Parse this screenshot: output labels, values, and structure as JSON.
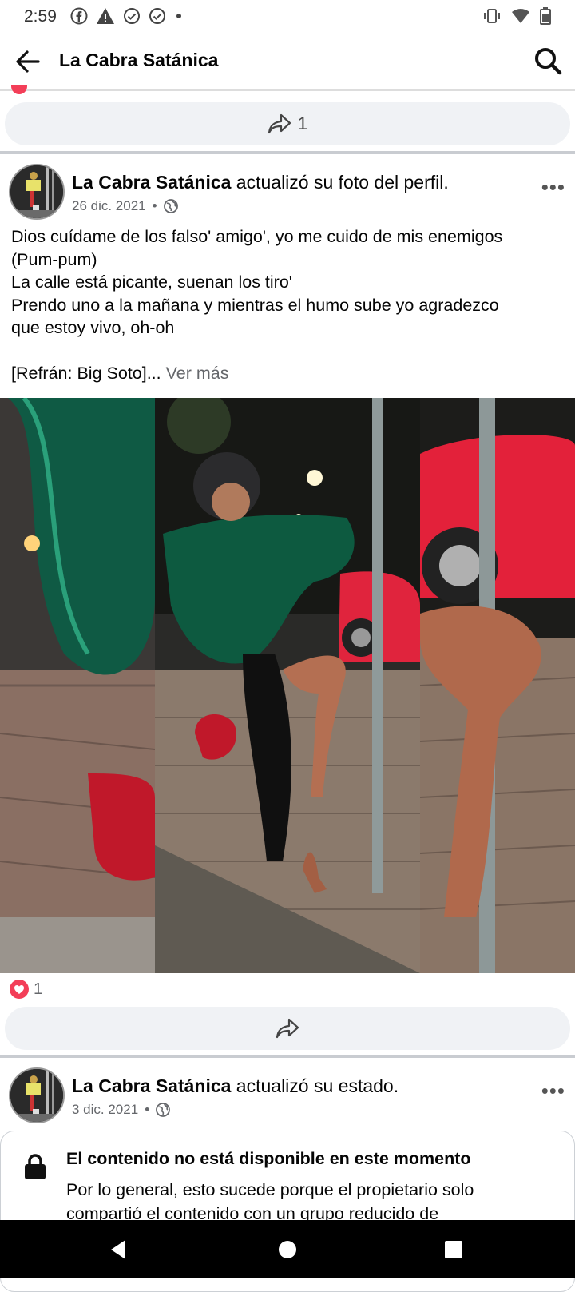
{
  "status_bar": {
    "time": "2:59"
  },
  "header": {
    "title": "La Cabra Satánica"
  },
  "prev_post": {
    "share_count": "1"
  },
  "post1": {
    "author": "La Cabra Satánica",
    "action": " actualizó su foto del perfil.",
    "date": "26 dic. 2021",
    "lines": [
      "Dios cuídame de los falso' amigo', yo me cuido de mis enemigos",
      "(Pum-pum)",
      "La calle está picante, suenan los tiro'",
      "Prendo uno a la mañana y mientras el humo sube yo agradezco",
      "que estoy vivo, oh-oh",
      "",
      "[Refrán: Big Soto]..."
    ],
    "see_more": "Ver más",
    "reaction_count": "1"
  },
  "post2": {
    "author": "La Cabra Satánica",
    "action": " actualizó su estado.",
    "date": "3 dic. 2021",
    "unavailable_title": "El contenido no está disponible en este momento",
    "unavailable_desc": "Por lo general, esto sucede porque el propietario solo compartió el contenido con un grupo reducido de"
  }
}
